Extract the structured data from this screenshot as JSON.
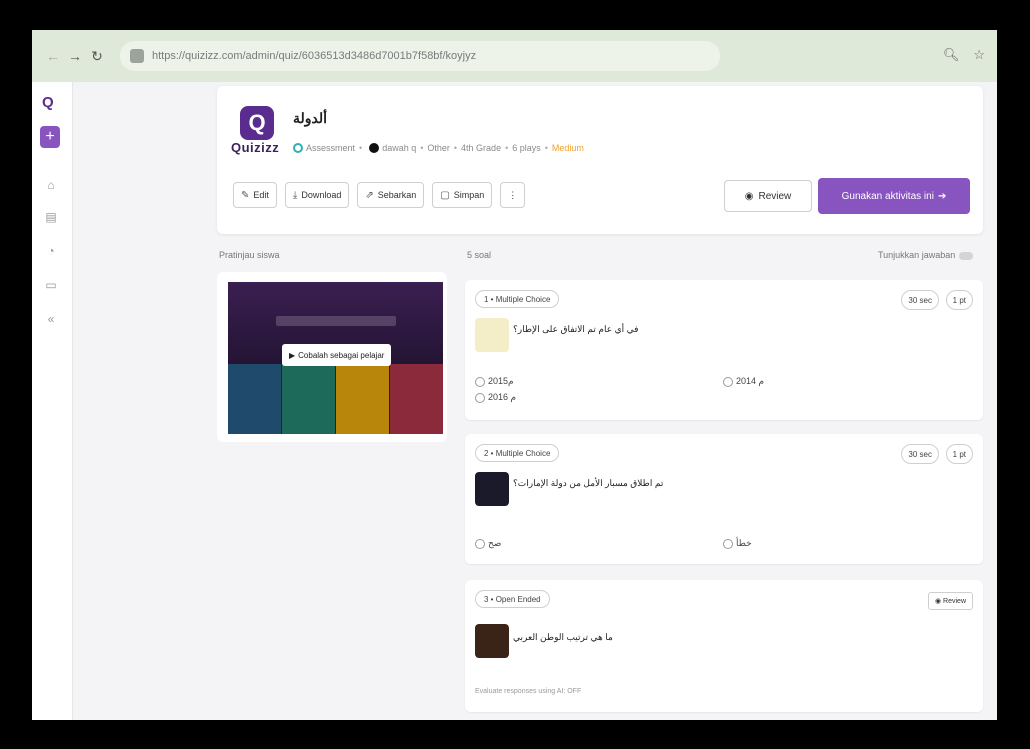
{
  "browser": {
    "url": "https://quizizz.com/admin/quiz/6036513d3486d7001b7f58bf/koyjyz",
    "zoom_icon": "zoom-icon",
    "star_icon": "star-icon"
  },
  "rail": {
    "logo": "Q",
    "plus": "+"
  },
  "quiz": {
    "brand": "Quizizz",
    "title": "ألدولة",
    "type": "Assessment",
    "author": "dawah q",
    "subject": "Other",
    "grade": "4th Grade",
    "plays": "6 plays",
    "difficulty": "Medium"
  },
  "toolbar": {
    "edit": "Edit",
    "download": "Download",
    "share": "Sebarkan",
    "save": "Simpan",
    "more": "⋮",
    "review": "Review",
    "assign": "Gunakan aktivitas ini"
  },
  "sections": {
    "preview_label": "Pratinjau siswa",
    "questions_label": "5 soal",
    "show_answers": "Tunjukkan jawaban"
  },
  "preview": {
    "play_label": "Cobalah sebagai pelajar"
  },
  "questions": [
    {
      "type": "1 • Multiple Choice",
      "time": "30 sec",
      "points": "1 pt",
      "text": "في أي عام تم الاتفاق على الإطار؟",
      "options": [
        "2015م",
        "2014 م",
        "2016 م"
      ]
    },
    {
      "type": "2 • Multiple Choice",
      "time": "30 sec",
      "points": "1 pt",
      "text": "تم اطلاق مسبار الأمل من دولة الإمارات؟",
      "options": [
        "صح",
        "خطأ"
      ]
    },
    {
      "type": "3 • Open Ended",
      "review": "Review",
      "text": "ما هي ترتيب الوطن العربي",
      "eval": "Evaluate responses using AI: OFF"
    }
  ],
  "colors": {
    "accent": "#8854c0",
    "brand_dark": "#5b2c8f",
    "difficulty": "#f0a030",
    "browser_bar": "#dfe9da"
  }
}
